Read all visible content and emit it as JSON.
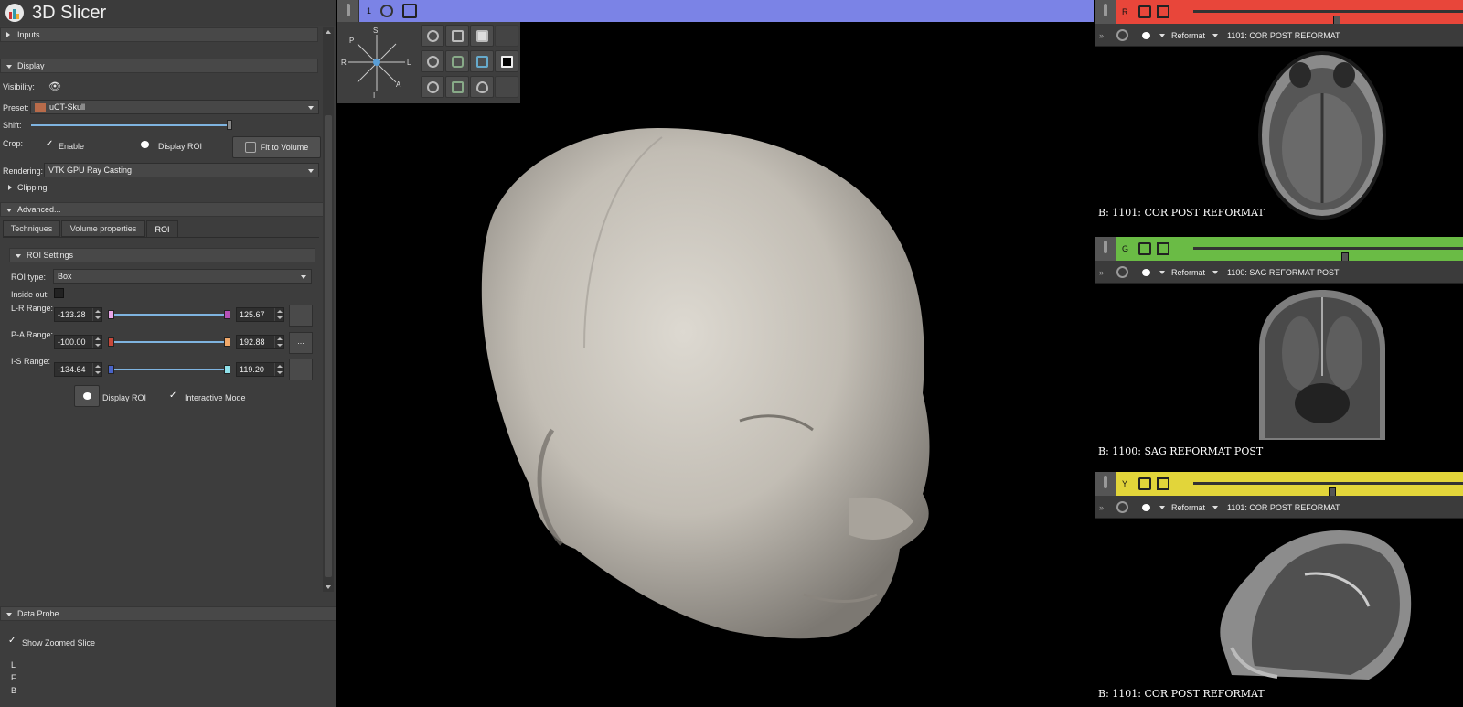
{
  "app": {
    "title": "3D Slicer"
  },
  "left": {
    "inputs_label": "Inputs",
    "display_label": "Display",
    "visibility_label": "Visibility:",
    "preset_label": "Preset:",
    "preset_value": "uCT-Skull",
    "shift_label": "Shift:",
    "crop_label": "Crop:",
    "enable_label": "Enable",
    "display_roi_label": "Display ROI",
    "fit_label": "Fit to Volume",
    "rendering_label": "Rendering:",
    "rendering_value": "VTK GPU Ray Casting",
    "clipping_label": "Clipping",
    "advanced_label": "Advanced...",
    "tabs": [
      "Techniques",
      "Volume properties",
      "ROI"
    ],
    "roi_settings_label": "ROI Settings",
    "roi_type_label": "ROI type:",
    "roi_type_value": "Box",
    "inside_out_label": "Inside out:",
    "lr_label": "L-R Range:",
    "lr_min": "-133.28",
    "lr_max": "125.67",
    "pa_label": "P-A Range:",
    "pa_min": "-100.00",
    "pa_max": "192.88",
    "is_label": "I-S Range:",
    "is_min": "-134.64",
    "is_max": "119.20",
    "more_label": "...",
    "display_roi2_label": "Display ROI",
    "interactive_label": "Interactive Mode",
    "data_probe_label": "Data Probe",
    "show_zoomed_label": "Show Zoomed Slice",
    "probe_lines": [
      "L",
      "F",
      "B"
    ]
  },
  "view3d": {
    "bar_label": "1",
    "bar_color": "#7b83e6",
    "orient": {
      "s": "S",
      "i": "I",
      "r": "R",
      "l": "L",
      "p": "P",
      "a": "A"
    }
  },
  "slices": [
    {
      "letter": "R",
      "color": "#e8463a",
      "mode": "Reformat",
      "volume": "1101: COR POST REFORMAT",
      "caption": "B: 1101: COR POST REFORMAT",
      "slider": 0.52
    },
    {
      "letter": "G",
      "color": "#6abb45",
      "mode": "Reformat",
      "volume": "1100: SAG REFORMAT POST",
      "caption": "B: 1100: SAG REFORMAT POST",
      "slider": 0.55
    },
    {
      "letter": "Y",
      "color": "#e2d53a",
      "mode": "Reformat",
      "volume": "1101: COR POST REFORMAT",
      "caption": "B: 1101: COR POST REFORMAT",
      "slider": 0.5
    }
  ],
  "colors": {
    "panel": "#3d3d3d",
    "accent": "#7fb4e0"
  }
}
